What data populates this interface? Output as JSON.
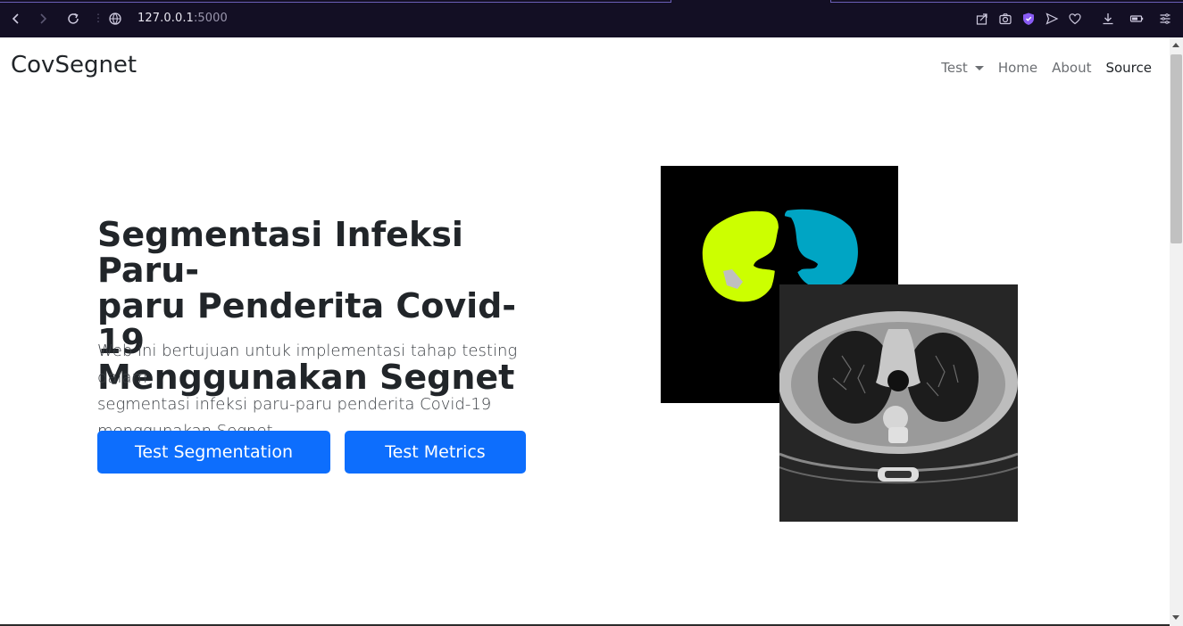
{
  "browser": {
    "url_host": "127.0.0.1",
    "url_port": ":5000",
    "icons": [
      "back-icon",
      "forward-icon",
      "reload-icon",
      "site-info-icon",
      "share-icon",
      "camera-icon",
      "shield-icon",
      "send-icon",
      "heart-icon",
      "download-icon",
      "battery-icon",
      "menu-icon"
    ]
  },
  "navbar": {
    "brand": "CovSegnet",
    "items": [
      {
        "label": "Test",
        "dropdown": true
      },
      {
        "label": "Home"
      },
      {
        "label": "About"
      },
      {
        "label": "Source",
        "active": true
      }
    ]
  },
  "hero": {
    "title": "Segmentasi Infeksi Paru-paru Penderita Covid-19 Menggunakan Segnet",
    "title_lines": [
      "Segmentasi Infeksi Paru-",
      "paru Penderita Covid-19",
      "Menggunakan Segnet"
    ],
    "lead_lines": [
      "Web ini bertujuan untuk implementasi tahap testing dalam",
      "segmentasi infeksi paru-paru penderita Covid-19",
      "menggunakan Segnet."
    ],
    "buttons": {
      "segmentation": "Test Segmentation",
      "metrics": "Test Metrics"
    }
  },
  "colors": {
    "primary": "#0d6efd",
    "mask_left_lung": "#ccff00",
    "mask_right_lung": "#00a5c4",
    "mask_infection": "#bfbfbf",
    "browser_bar": "#130f24"
  }
}
